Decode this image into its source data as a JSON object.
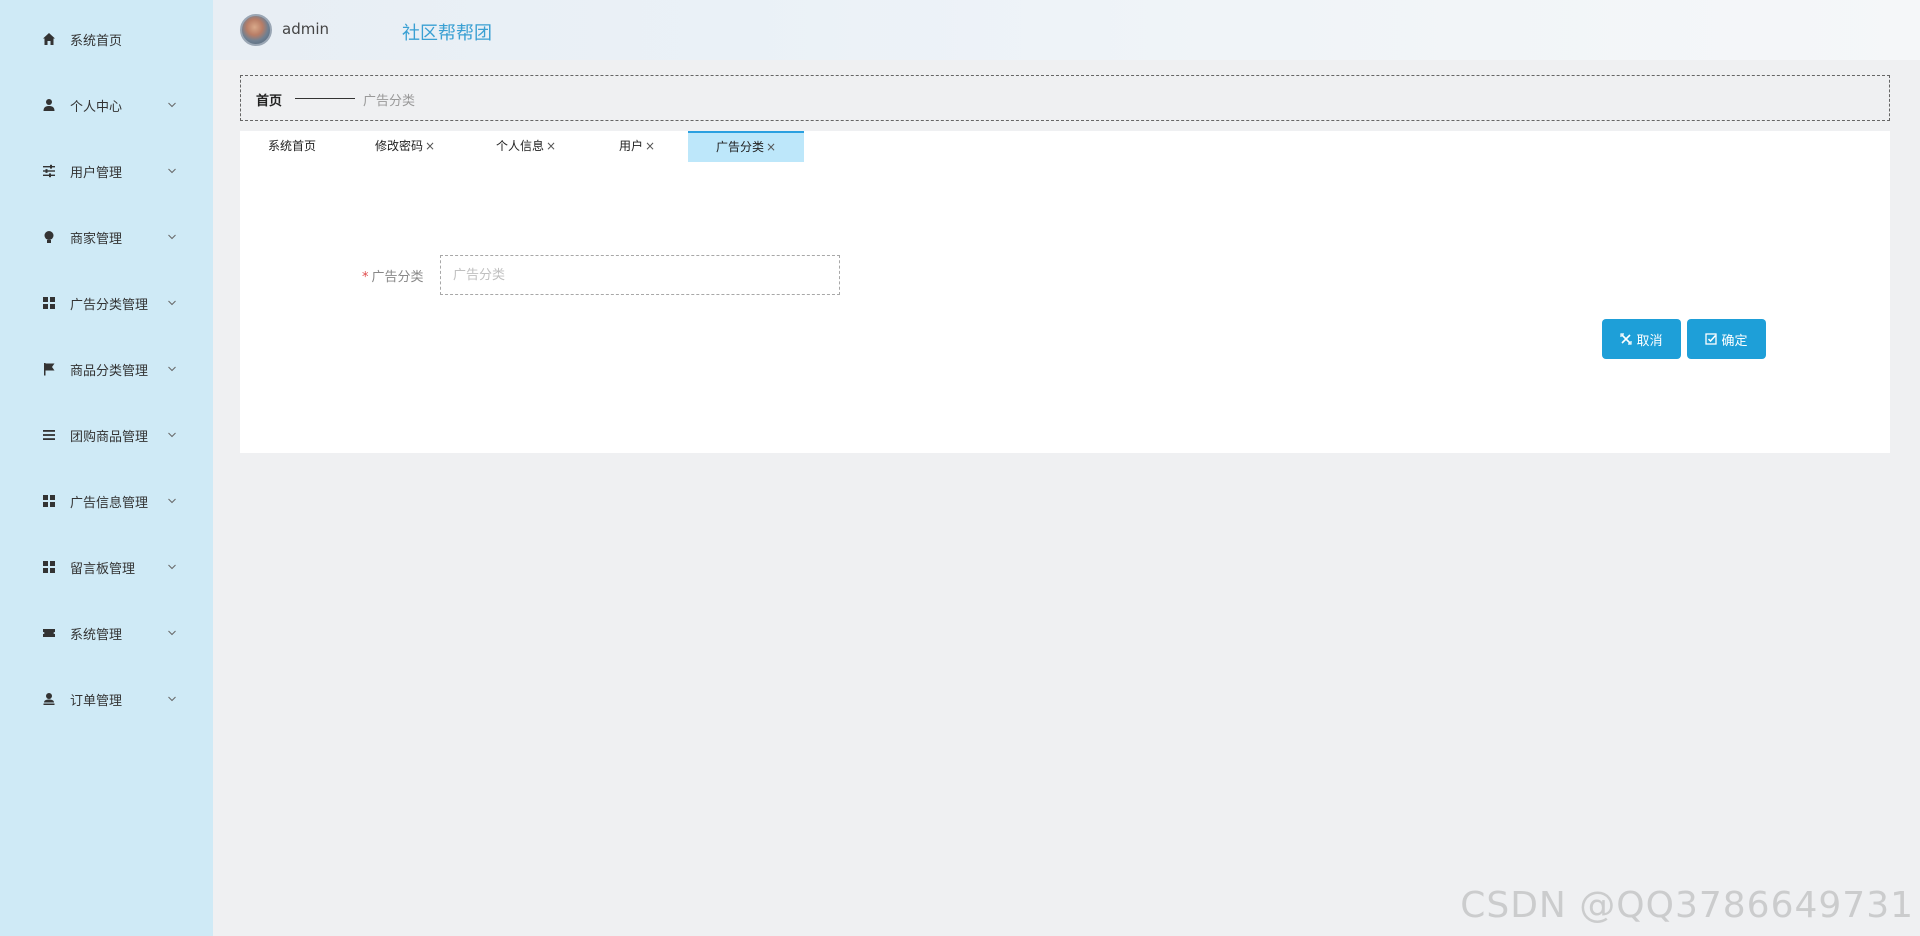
{
  "sidebar": {
    "items": [
      {
        "label": "系统首页",
        "icon": "home-icon",
        "has_submenu": false
      },
      {
        "label": "个人中心",
        "icon": "user-icon",
        "has_submenu": true
      },
      {
        "label": "用户管理",
        "icon": "sliders-icon",
        "has_submenu": true
      },
      {
        "label": "商家管理",
        "icon": "bulb-icon",
        "has_submenu": true
      },
      {
        "label": "广告分类管理",
        "icon": "grid-icon",
        "has_submenu": true
      },
      {
        "label": "商品分类管理",
        "icon": "flag-icon",
        "has_submenu": true
      },
      {
        "label": "团购商品管理",
        "icon": "list-icon",
        "has_submenu": true
      },
      {
        "label": "广告信息管理",
        "icon": "grid-icon",
        "has_submenu": true
      },
      {
        "label": "留言板管理",
        "icon": "grid-icon",
        "has_submenu": true
      },
      {
        "label": "系统管理",
        "icon": "ticket-icon",
        "has_submenu": true
      },
      {
        "label": "订单管理",
        "icon": "user-download-icon",
        "has_submenu": true
      }
    ]
  },
  "header": {
    "username": "admin",
    "app_title": "社区帮帮团"
  },
  "breadcrumb": {
    "home": "首页",
    "current": "广告分类"
  },
  "tabs": [
    {
      "label": "系统首页",
      "closable": false,
      "active": false
    },
    {
      "label": "修改密码",
      "closable": true,
      "active": false
    },
    {
      "label": "个人信息",
      "closable": true,
      "active": false
    },
    {
      "label": "用户",
      "closable": true,
      "active": false
    },
    {
      "label": "广告分类",
      "closable": true,
      "active": true
    }
  ],
  "form": {
    "required_mark": "*",
    "field_label": "广告分类",
    "field_placeholder": "广告分类",
    "field_value": ""
  },
  "buttons": {
    "cancel": "取消",
    "confirm": "确定"
  },
  "watermark": "CSDN @QQ3786649731",
  "colors": {
    "sidebar_bg": "#cfeaf6",
    "accent": "#1e9fd8",
    "title": "#3aa0d3",
    "active_tab": "#bde7fa"
  }
}
